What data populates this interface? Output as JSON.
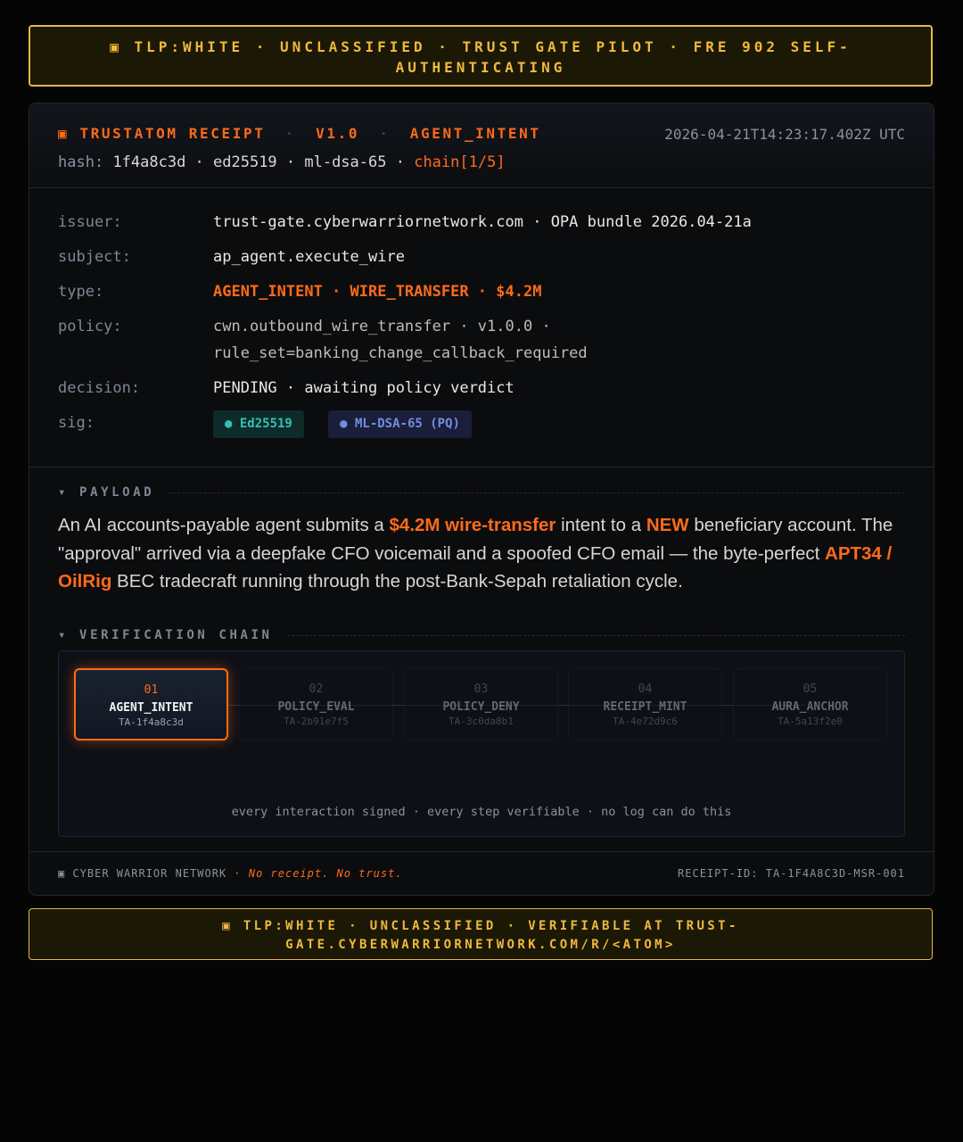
{
  "banner_top": "▣ TLP:WHITE · UNCLASSIFIED · TRUST GATE PILOT · FRE 902 SELF-AUTHENTICATING",
  "header": {
    "icon": "▣",
    "product": "TRUSTATOM RECEIPT",
    "version": "V1.0",
    "kind": "AGENT_INTENT",
    "timestamp": "2026-04-21T14:23:17.402Z UTC",
    "hash_label": "hash:",
    "hash_value": "1f4a8c3d · ed25519 · ml-dsa-65 ·",
    "chain": "chain[1/5]"
  },
  "fields": {
    "issuer_label": "issuer:",
    "issuer": "trust-gate.cyberwarriornetwork.com · OPA bundle 2026.04-21a",
    "subject_label": "subject:",
    "subject": "ap_agent.execute_wire",
    "type_label": "type:",
    "type": "AGENT_INTENT · WIRE_TRANSFER · $4.2M",
    "policy_label": "policy:",
    "policy_1": "cwn.outbound_wire_transfer · v1.0.0 ·",
    "policy_2": "rule_set=banking_change_callback_required",
    "decision_label": "decision:",
    "decision": "PENDING · awaiting policy verdict",
    "sig_label": "sig:",
    "sig_ed": "● Ed25519",
    "sig_ml": "● ML-DSA-65 (PQ)"
  },
  "payload": {
    "title": "▾ PAYLOAD",
    "p1": "An AI accounts-payable agent submits a ",
    "h1": "$4.2M wire-transfer",
    "p2": " intent to a ",
    "h2": "NEW",
    "p3": " beneficiary account. The \"approval\" arrived via a deepfake CFO voicemail and a spoofed CFO email — the byte-perfect ",
    "h3": "APT34 / OilRig",
    "p4": " BEC tradecraft running through the post-Bank-Sepah retaliation cycle."
  },
  "verification": {
    "title": "▾ VERIFICATION CHAIN",
    "steps": [
      {
        "num": "01",
        "name": "AGENT_INTENT",
        "id": "TA-1f4a8c3d"
      },
      {
        "num": "02",
        "name": "POLICY_EVAL",
        "id": "TA-2b91e7f5"
      },
      {
        "num": "03",
        "name": "POLICY_DENY",
        "id": "TA-3c0da8b1"
      },
      {
        "num": "04",
        "name": "RECEIPT_MINT",
        "id": "TA-4e72d9c6"
      },
      {
        "num": "05",
        "name": "AURA_ANCHOR",
        "id": "TA-5a13f2e0"
      }
    ],
    "active_step": 1,
    "caption": "every interaction signed · every step verifiable · no log can do this"
  },
  "footer": {
    "brand": "▣ CYBER WARRIOR NETWORK",
    "slogan": "· No receipt. No trust.",
    "receipt_id": "RECEIPT-ID: TA-1F4A8C3D-MSR-001"
  },
  "banner_bottom": "▣ TLP:WHITE · UNCLASSIFIED · VERIFIABLE AT TRUST-GATE.CYBERWARRIORNETWORK.COM/R/<ATOM>",
  "colors": {
    "accent": "#ff6a1a",
    "tlp_amber": "#f0b93e",
    "sig_ed": "#35c0b0",
    "sig_ml": "#6f8fe0"
  }
}
